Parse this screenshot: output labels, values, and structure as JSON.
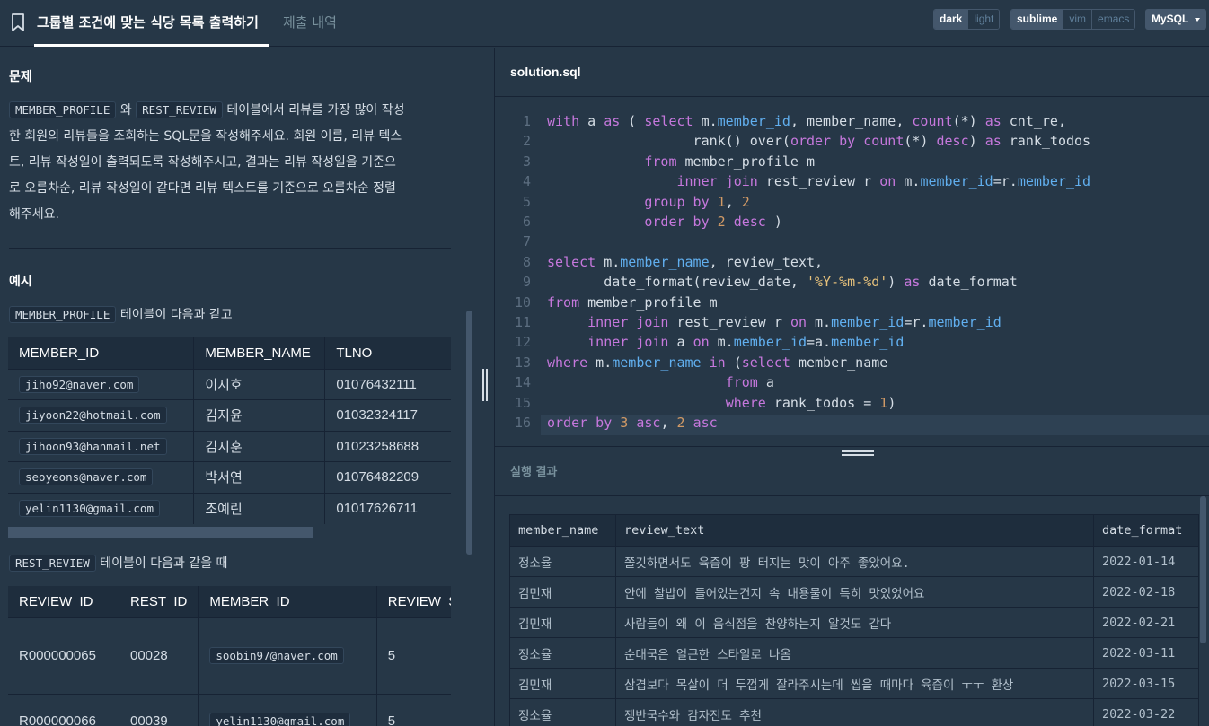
{
  "header": {
    "title": "그룹별 조건에 맞는 식당 목록 출력하기",
    "submissions_tab": "제출 내역",
    "theme": [
      "dark",
      "light"
    ],
    "keymap": [
      "sublime",
      "vim",
      "emacs"
    ],
    "language": "MySQL"
  },
  "problem": {
    "heading": "문제",
    "code_member_profile": "MEMBER_PROFILE",
    "code_rest_review": "REST_REVIEW",
    "wa": "와",
    "text_1": "테이블에서 리뷰를 가장 많이 작성",
    "text_2": "한 회원의 리뷰들을 조회하는 SQL문을 작성해주세요. 회원 이름, 리뷰 텍스",
    "text_3": "트, 리뷰 작성일이 출력되도록 작성해주시고, 결과는 리뷰 작성일을 기준으",
    "text_4": "로 오름차순, 리뷰 작성일이 같다면 리뷰 텍스트를 기준으로 오름차순 정렬",
    "text_5": "해주세요."
  },
  "example": {
    "heading": "예시",
    "member_label_code": "MEMBER_PROFILE",
    "member_label_text": "테이블이 다음과 같고",
    "member_table": {
      "headers": [
        "MEMBER_ID",
        "MEMBER_NAME",
        "TLNO"
      ],
      "rows": [
        [
          "jiho92@naver.com",
          "이지호",
          "01076432111"
        ],
        [
          "jiyoon22@hotmail.com",
          "김지윤",
          "01032324117"
        ],
        [
          "jihoon93@hanmail.net",
          "김지훈",
          "01023258688"
        ],
        [
          "seoyeons@naver.com",
          "박서연",
          "01076482209"
        ],
        [
          "yelin1130@gmail.com",
          "조예린",
          "01017626711"
        ]
      ]
    },
    "review_label_code": "REST_REVIEW",
    "review_label_text": "테이블이 다음과 같을 때",
    "review_table": {
      "headers": [
        "REVIEW_ID",
        "REST_ID",
        "MEMBER_ID",
        "REVIEW_S"
      ],
      "rows": [
        [
          "R000000065",
          "00028",
          "soobin97@naver.com",
          "5"
        ],
        [
          "R000000066",
          "00039",
          "yelin1130@gmail.com",
          "5"
        ]
      ]
    }
  },
  "editor": {
    "filename": "solution.sql",
    "line_numbers": [
      "1",
      "2",
      "3",
      "4",
      "5",
      "6",
      "7",
      "8",
      "9",
      "10",
      "11",
      "12",
      "13",
      "14",
      "15",
      "16"
    ]
  },
  "results": {
    "heading": "실행 결과",
    "headers": [
      "member_name",
      "review_text",
      "date_format"
    ],
    "rows": [
      [
        "정소율",
        "쫄깃하면서도 육즙이 팡 터지는 맛이 아주 좋았어요.",
        "2022-01-14"
      ],
      [
        "김민재",
        "안에 찰밥이 들어있는건지 속 내용물이 특히 맛있었어요",
        "2022-02-18"
      ],
      [
        "김민재",
        "사람들이 왜 이 음식점을 찬양하는지 알것도 같다",
        "2022-02-21"
      ],
      [
        "정소율",
        "순대국은 얼큰한 스타일로 나옴",
        "2022-03-11"
      ],
      [
        "김민재",
        "삼겹보다 목살이 더 두껍게 잘라주시는데 씹을 때마다 육즙이 ㅜㅜ 환상",
        "2022-03-15"
      ],
      [
        "정소율",
        "쟁반국수와 감자전도 추천",
        "2022-03-22"
      ]
    ]
  }
}
